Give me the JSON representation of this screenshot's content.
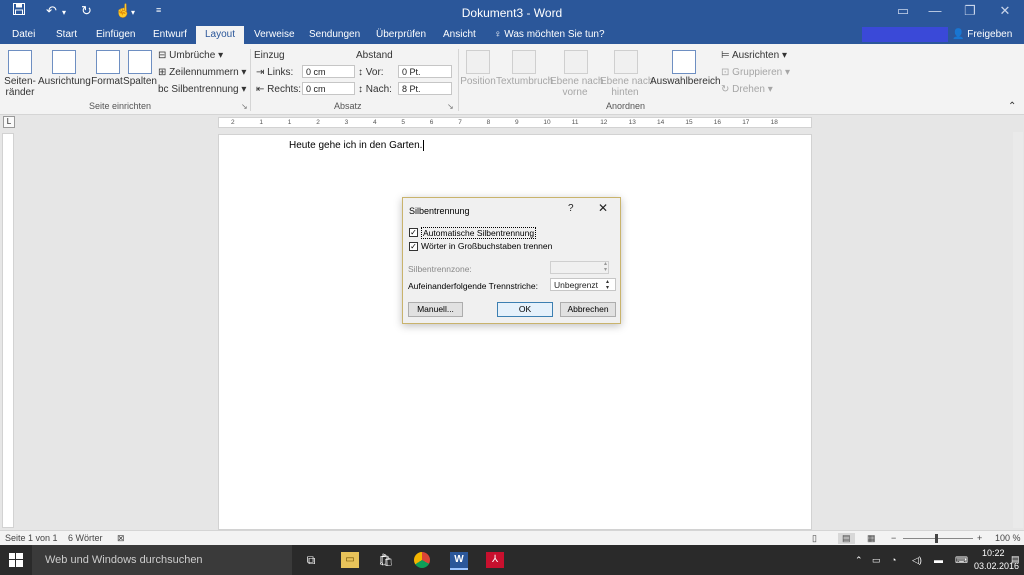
{
  "titlebar": {
    "title": "Dokument3 - Word"
  },
  "tabs": [
    "Datei",
    "Start",
    "Einfügen",
    "Entwurf",
    "Layout",
    "Verweise",
    "Sendungen",
    "Überprüfen",
    "Ansicht"
  ],
  "active_tab": "Layout",
  "tellme": "Was möchten Sie tun?",
  "share": "Freigeben",
  "ribbon": {
    "seite_einrichten": {
      "group_label": "Seite einrichten",
      "seitenraender": "Seiten-\nränder",
      "ausrichtung": "Ausrichtung",
      "format": "Format",
      "spalten": "Spalten",
      "umbrueche": "Umbrüche",
      "zeilennummern": "Zeilennummern",
      "silbentrennung": "Silbentrennung"
    },
    "absatz": {
      "group_label": "Absatz",
      "einzug_label": "Einzug",
      "abstand_label": "Abstand",
      "links_label": "Links:",
      "links_value": "0 cm",
      "rechts_label": "Rechts:",
      "rechts_value": "0 cm",
      "vor_label": "Vor:",
      "vor_value": "0 Pt.",
      "nach_label": "Nach:",
      "nach_value": "8 Pt."
    },
    "anordnen": {
      "group_label": "Anordnen",
      "position": "Position",
      "textumbruch": "Textumbruch",
      "ebene_vorne": "Ebene nach\nvorne",
      "ebene_hinten": "Ebene nach\nhinten",
      "auswahlbereich": "Auswahlbereich",
      "ausrichten": "Ausrichten",
      "gruppieren": "Gruppieren",
      "drehen": "Drehen"
    }
  },
  "ruler": {
    "ticks": [
      "2",
      "1",
      "1",
      "2",
      "3",
      "4",
      "5",
      "6",
      "7",
      "8",
      "9",
      "10",
      "11",
      "12",
      "13",
      "14",
      "15",
      "16",
      "17",
      "18"
    ]
  },
  "document": {
    "text": "Heute gehe ich in den Garten."
  },
  "dialog": {
    "title": "Silbentrennung",
    "help": "?",
    "close": "✕",
    "auto_label": "Automatische Silbentrennung",
    "auto_checked": true,
    "caps_label": "Wörter in Großbuchstaben trennen",
    "caps_checked": true,
    "zone_label": "Silbentrennzone:",
    "zone_value": "",
    "consecutive_label": "Aufeinanderfolgende Trennstriche:",
    "consecutive_value": "Unbegrenzt",
    "manual_button": "Manuell...",
    "ok_button": "OK",
    "cancel_button": "Abbrechen"
  },
  "statusbar": {
    "page": "Seite 1 von 1",
    "words": "6 Wörter",
    "zoom": "100 %",
    "zoom_minus": "−",
    "zoom_plus": "+"
  },
  "taskbar": {
    "search_placeholder": "Web und Windows durchsuchen",
    "time": "10:22",
    "date": "03.02.2016"
  },
  "colors": {
    "word_blue": "#2b579a",
    "account_blue": "#3a49d8",
    "taskbar": "#2a2a2a"
  }
}
